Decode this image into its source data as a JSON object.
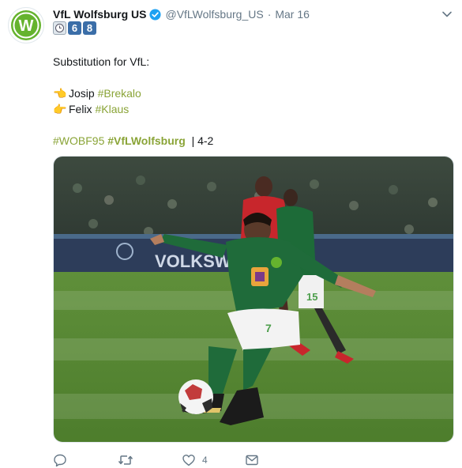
{
  "author": {
    "name": "VfL Wolfsburg US",
    "handle": "@VfLWolfsburg_US",
    "separator": "·",
    "date": "Mar 16",
    "badges": [
      "6",
      "8"
    ]
  },
  "tweet": {
    "line1": "Substitution for VfL:",
    "line2_name": "Josip",
    "line2_tag": "#Brekalo",
    "line3_name": "Felix",
    "line3_tag": "#Klaus",
    "line4_tag1": "#WOBF95",
    "line4_tag2": "#VfLWolfsburg",
    "line4_score": "| 4-2"
  },
  "media": {
    "stadium_text": "VOLKSW",
    "shirt_number_front": "7",
    "shirt_number_back": "15"
  },
  "actions": {
    "like_count": "4"
  },
  "colors": {
    "hashtag": "#8aa437",
    "verified": "#1da1f2",
    "icon_gray": "#657786"
  }
}
